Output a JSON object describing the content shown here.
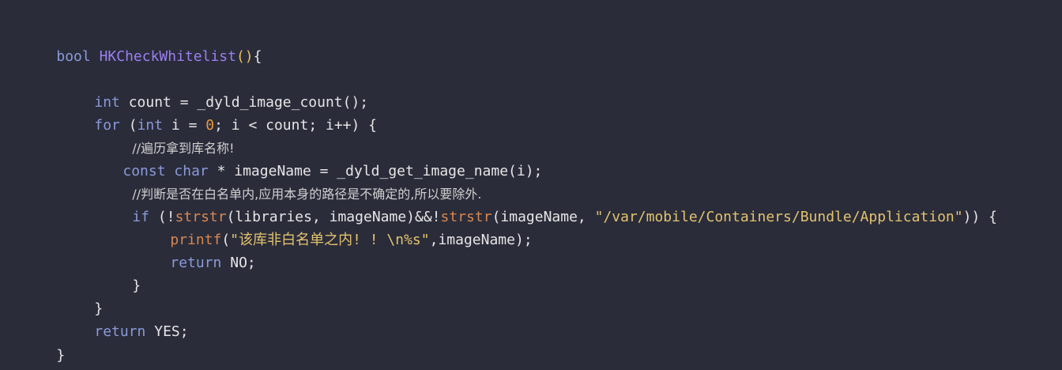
{
  "code": {
    "l1": {
      "kw": "bool",
      "sp": " ",
      "name": "HKCheckWhitelist",
      "parens": "()",
      "brace": "{"
    },
    "l3": {
      "kw": "int",
      "rest": " count = _dyld_image_count();"
    },
    "l4": {
      "kw": "for",
      "a": " (",
      "kw2": "int",
      "b": " i = ",
      "num": "0",
      "c": "; i < count; i++) {"
    },
    "l5": {
      "comment": "//遍历拿到库名称!"
    },
    "l6": {
      "kw": "const",
      "sp": " ",
      "kw2": "char",
      "rest": " * imageName = _dyld_get_image_name(i);"
    },
    "l7": {
      "comment": "//判断是否在白名单内,应用本身的路径是不确定的,所以要除外."
    },
    "l8": {
      "kw": "if",
      "a": " (!",
      "fn1": "strstr",
      "b": "(libraries, imageName)&&!",
      "fn2": "strstr",
      "c": "(imageName, ",
      "str": "\"/var/mobile/Containers/Bundle/Application\"",
      "d": ")) {"
    },
    "l9": {
      "fn": "printf",
      "a": "(",
      "str": "\"该库非白名单之内! ! \\n%s\"",
      "b": ",imageName);"
    },
    "l10": {
      "kw": "return",
      "rest": " NO;"
    },
    "l11": {
      "text": "}"
    },
    "l12": {
      "text": "}"
    },
    "l13": {
      "kw": "return",
      "rest": " YES;"
    },
    "l14": {
      "text": "}"
    }
  }
}
